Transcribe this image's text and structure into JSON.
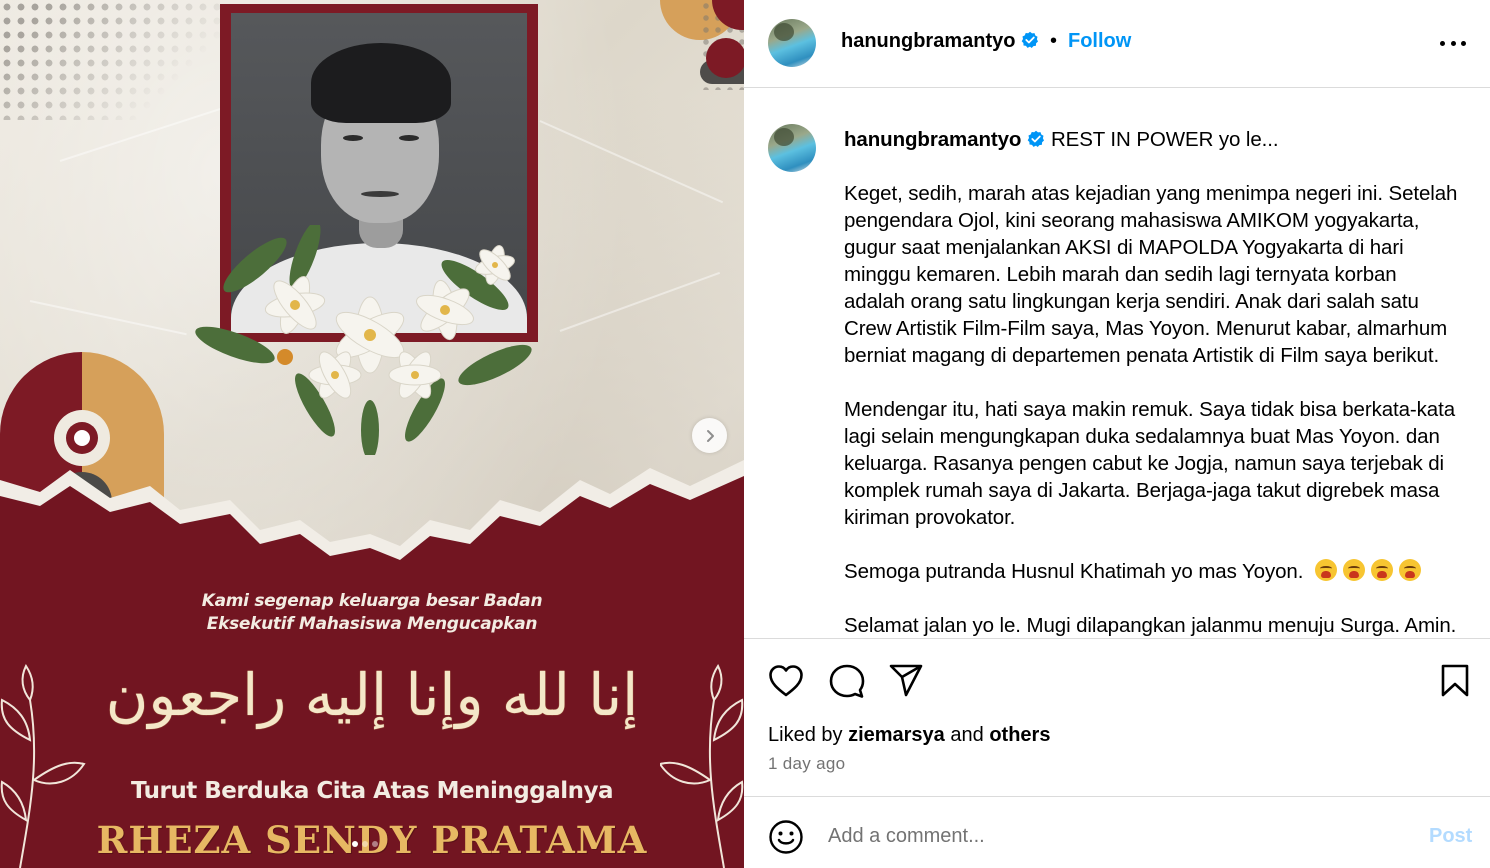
{
  "post_image": {
    "greeting_line1": "Kami segenap keluarga besar Badan",
    "greeting_line2": "Eksekutif Mahasiswa Mengucapkan",
    "arabic_text": "إنا لله وإنا إليه راجعون",
    "condolence": "Turut Berduka Cita Atas Meninggalnya",
    "deceased_name": "RHEZA SENDY PRATAMA",
    "carousel_total": 3,
    "carousel_current": 1,
    "next_icon": "chevron-right-icon"
  },
  "header": {
    "username": "hanungbramantyo",
    "verified_icon": "verified-badge-icon",
    "separator": "•",
    "follow_label": "Follow",
    "more_icon": "more-options-icon"
  },
  "caption": {
    "username": "hanungbramantyo",
    "first_line": "REST IN POWER yo le...",
    "paragraph1": [
      "Keget, sedih, marah atas kejadian yang menimpa negeri ini. Setelah",
      "pengendara Ojol, kini seorang mahasiswa AMIKOM yogyakarta,",
      "gugur saat menjalankan AKSI di MAPOLDA Yogyakarta di hari",
      "minggu kemaren. Lebih marah dan sedih lagi ternyata korban",
      "adalah orang satu lingkungan kerja sendiri. Anak dari salah satu",
      "Crew Artistik Film-Film saya, Mas Yoyon. Menurut kabar, almarhum",
      "berniat magang di departemen penata Artistik di Film saya berikut."
    ],
    "paragraph2": [
      "Mendengar itu, hati saya makin remuk. Saya tidak bisa berkata-kata",
      "lagi selain mengungkapan duka sedalamnya buat Mas Yoyon. dan",
      "keluarga. Rasanya pengen cabut ke Jogja, namun saya terjebak di",
      "komplek rumah saya di Jakarta. Berjaga-jaga takut digrebek masa",
      "kiriman provokator."
    ],
    "paragraph3": "Semoga putranda Husnul Khatimah yo mas Yoyon.",
    "paragraph3_emoji_count": 4,
    "paragraph4": "Selamat jalan yo le. Mugi dilapangkan jalanmu menuju Surga. Amin."
  },
  "actions": {
    "like_icon": "heart-icon",
    "comment_icon": "comment-icon",
    "share_icon": "send-icon",
    "save_icon": "bookmark-icon"
  },
  "likes": {
    "prefix": "Liked by",
    "user": "ziemarsya",
    "and": "and",
    "others": "others"
  },
  "timestamp": "1 day ago",
  "comment": {
    "emoji_icon": "emoji-smile-icon",
    "placeholder": "Add a comment...",
    "post_label": "Post"
  },
  "colors": {
    "link_blue": "#0095f6",
    "post_disabled": "#b3dbff",
    "maroon": "#7d1a25",
    "gold": "#d6a05a",
    "muted_text": "#737373"
  }
}
